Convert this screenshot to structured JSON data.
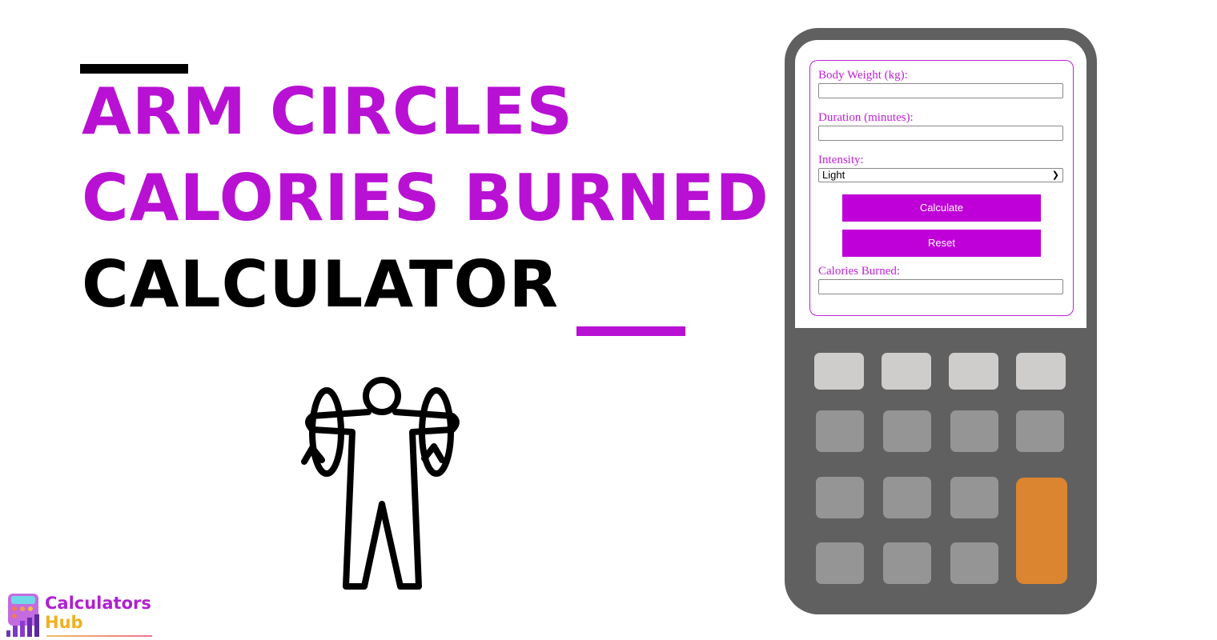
{
  "title": {
    "line1": "ARM CIRCLES",
    "line2": "CALORIES BURNED",
    "line3": "CALCULATOR"
  },
  "colors": {
    "accent": "#b811d4",
    "dark": "#000000",
    "calc_body": "#606061",
    "key_orange": "#db8530"
  },
  "form": {
    "weight_label": "Body Weight (kg):",
    "weight_value": "",
    "duration_label": "Duration (minutes):",
    "duration_value": "",
    "intensity_label": "Intensity:",
    "intensity_value": "Light",
    "calculate_label": "Calculate",
    "reset_label": "Reset",
    "result_label": "Calories Burned:",
    "result_value": ""
  },
  "logo": {
    "line1": "Calculators",
    "line2": "Hub"
  },
  "illustration": "arm-circles-person-icon"
}
